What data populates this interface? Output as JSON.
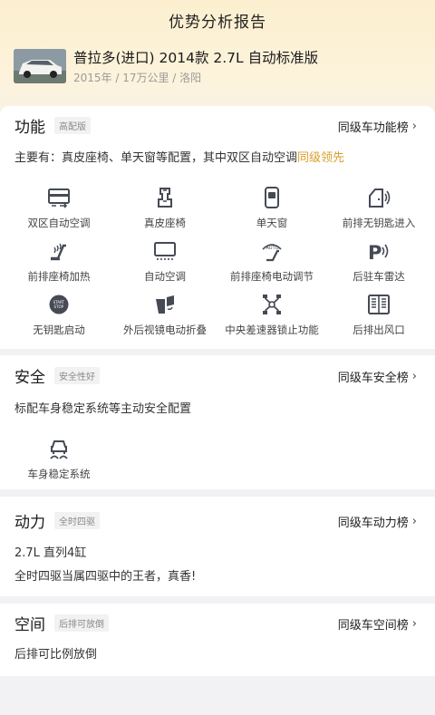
{
  "header": {
    "title": "优势分析报告"
  },
  "car": {
    "name": "普拉多(进口) 2014款 2.7L 自动标准版",
    "meta": "2015年 / 17万公里 / 洛阳"
  },
  "sections": {
    "features": {
      "title": "功能",
      "tag": "高配版",
      "rank": "同级车功能榜",
      "desc_main": "主要有：真皮座椅、单天窗等配置，其中双区自动空调",
      "desc_highlight": "同级领先",
      "items": [
        {
          "label": "双区自动空调",
          "icon": "dual-zone-ac-icon"
        },
        {
          "label": "真皮座椅",
          "icon": "leather-seat-icon"
        },
        {
          "label": "单天窗",
          "icon": "sunroof-icon"
        },
        {
          "label": "前排无钥匙进入",
          "icon": "keyless-entry-icon"
        },
        {
          "label": "前排座椅加热",
          "icon": "seat-heating-icon"
        },
        {
          "label": "自动空调",
          "icon": "auto-ac-icon"
        },
        {
          "label": "前排座椅电动调节",
          "icon": "power-seat-icon"
        },
        {
          "label": "后驻车雷达",
          "icon": "parking-radar-icon"
        },
        {
          "label": "无钥匙启动",
          "icon": "start-stop-icon"
        },
        {
          "label": "外后视镜电动折叠",
          "icon": "mirror-fold-icon"
        },
        {
          "label": "中央差速器锁止功能",
          "icon": "diff-lock-icon"
        },
        {
          "label": "后排出风口",
          "icon": "rear-vent-icon"
        }
      ]
    },
    "safety": {
      "title": "安全",
      "tag": "安全性好",
      "rank": "同级车安全榜",
      "desc": "标配车身稳定系统等主动安全配置",
      "items": [
        {
          "label": "车身稳定系统",
          "icon": "stability-control-icon"
        }
      ]
    },
    "power": {
      "title": "动力",
      "tag": "全时四驱",
      "rank": "同级车动力榜",
      "line1": "2.7L 直列4缸",
      "line2": "全时四驱当属四驱中的王者，真香!"
    },
    "space": {
      "title": "空间",
      "tag": "后排可放倒",
      "rank": "同级车空间榜",
      "desc": "后排可比例放倒"
    }
  },
  "colors": {
    "accent": "#d8a02a",
    "icon": "#454a55"
  }
}
